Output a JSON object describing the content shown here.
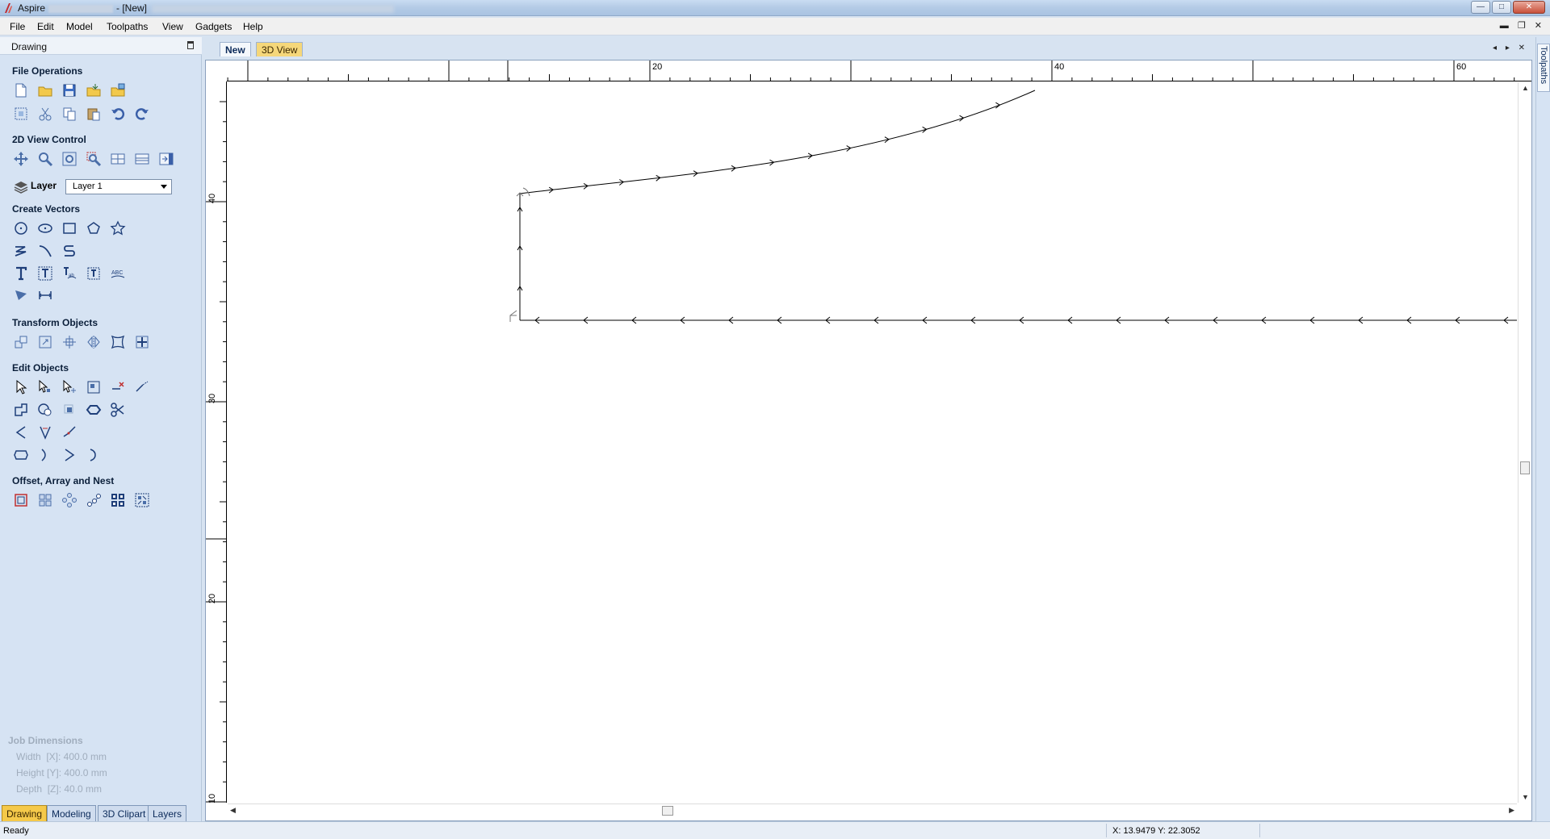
{
  "window": {
    "title_app": "Aspire",
    "title_doc": "- [New]",
    "buttons": [
      "minimize",
      "maximize",
      "close"
    ]
  },
  "menubar": {
    "items": [
      "File",
      "Edit",
      "Model",
      "Toolpaths",
      "View",
      "Gadgets",
      "Help"
    ]
  },
  "left_panel": {
    "title": "Drawing",
    "sections": {
      "file_operations": "File Operations",
      "view_control": "2D View Control",
      "create_vectors": "Create Vectors",
      "transform_objects": "Transform Objects",
      "edit_objects": "Edit Objects",
      "offset_array_nest": "Offset, Array and Nest"
    },
    "layer": {
      "label": "Layer",
      "value": "Layer 1"
    },
    "job_dimensions": {
      "title": "Job Dimensions",
      "width": "Width  [X]: 400.0 mm",
      "height": "Height [Y]: 400.0 mm",
      "depth": "Depth  [Z]: 40.0 mm"
    },
    "tabs": [
      "Drawing",
      "Modeling",
      "3D Clipart",
      "Layers"
    ],
    "active_tab": "Drawing"
  },
  "document": {
    "tabs": [
      "New",
      "3D View"
    ],
    "active_tab": "New",
    "ruler_top_labels": [
      "20",
      "40",
      "60"
    ],
    "ruler_left_labels": [
      "40",
      "30",
      "20",
      "10"
    ]
  },
  "right_panel": {
    "tab": "Toolpaths"
  },
  "statusbar": {
    "status": "Ready",
    "coords": "X: 13.9479 Y: 22.3052"
  },
  "colors": {
    "panel_bg": "#d6e3f3",
    "active_tab": "#f5c94a",
    "section_text": "#0b1f3a"
  }
}
